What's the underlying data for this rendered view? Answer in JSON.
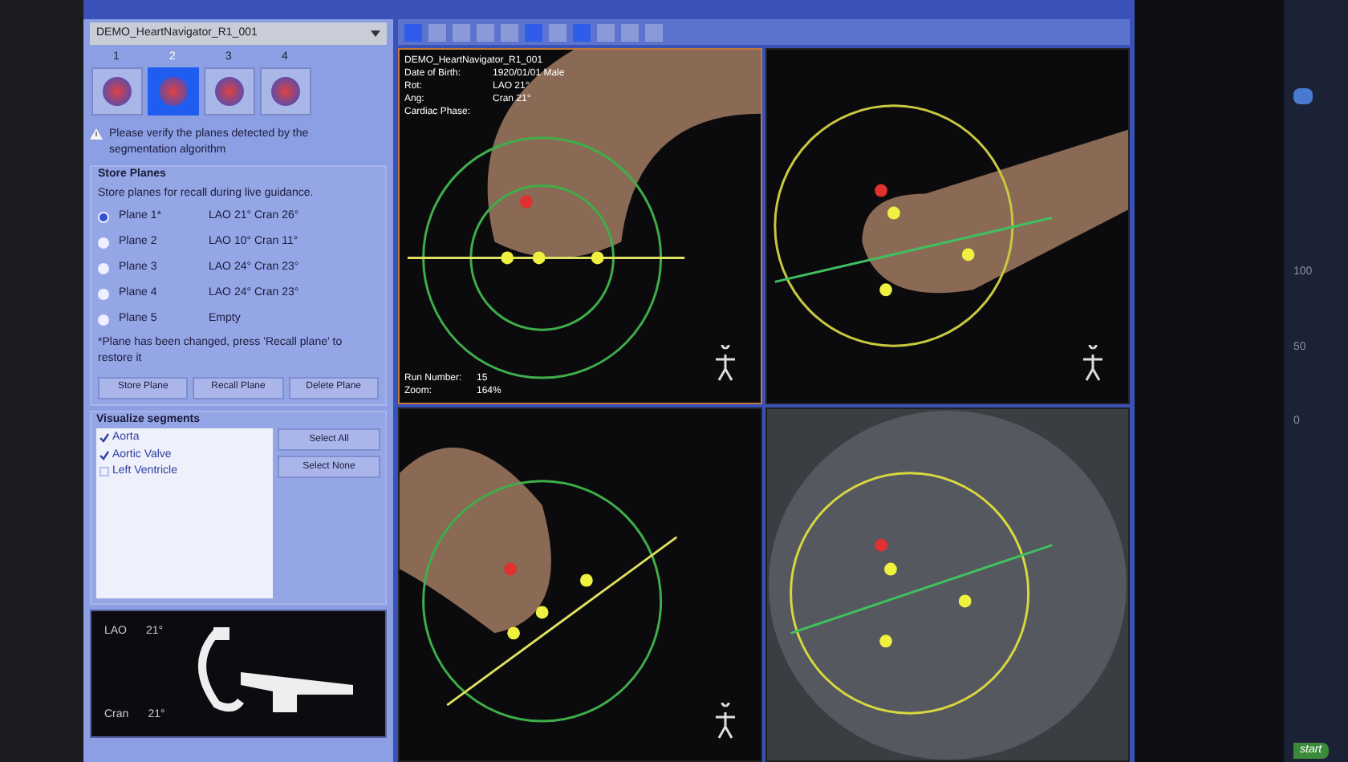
{
  "dataset": {
    "value": "DEMO_HeartNavigator_R1_001"
  },
  "steps": [
    {
      "label": "1",
      "selected": false
    },
    {
      "label": "2",
      "selected": true
    },
    {
      "label": "3",
      "selected": false
    },
    {
      "label": "4",
      "selected": false
    }
  ],
  "warning": "Please verify the planes detected by the segmentation algorithm",
  "store_planes": {
    "title": "Store Planes",
    "hint": "Store planes for recall during live guidance.",
    "planes": [
      {
        "name": "Plane 1*",
        "angles": "LAO 21° Cran 26°",
        "selected": true
      },
      {
        "name": "Plane 2",
        "angles": "LAO 10° Cran 11°",
        "selected": false
      },
      {
        "name": "Plane 3",
        "angles": "LAO 24° Cran 23°",
        "selected": false
      },
      {
        "name": "Plane 4",
        "angles": "LAO 24° Cran 23°",
        "selected": false
      },
      {
        "name": "Plane 5",
        "angles": "Empty",
        "selected": false
      }
    ],
    "note": "*Plane has been changed, press 'Recall plane' to restore it",
    "buttons": [
      "Store Plane",
      "Recall Plane",
      "Delete Plane"
    ]
  },
  "segments": {
    "title": "Visualize segments",
    "items": [
      {
        "label": "Aorta",
        "checked": true
      },
      {
        "label": "Aortic Valve",
        "checked": true
      },
      {
        "label": "Left Ventricle",
        "checked": false
      }
    ],
    "buttons": [
      "Select All",
      "Select None"
    ]
  },
  "carm": {
    "rot_label": "LAO",
    "rot_value": "21°",
    "ang_label": "Cran",
    "ang_value": "21°"
  },
  "viewport_info": [
    {
      "key": "DEMO_HeartNavigator_R1_001"
    },
    {
      "key": "Date of Birth:",
      "value": "1920/01/01 Male"
    },
    {
      "key": "Rot:",
      "value": "LAO 21°"
    },
    {
      "key": "Ang:",
      "value": "Cran 21°"
    },
    {
      "key": "Cardiac Phase:"
    }
  ],
  "viewport_footer": [
    {
      "key": "Run Number:",
      "value": "15"
    },
    {
      "key": "Zoom:",
      "value": "164%"
    }
  ],
  "monitor_scale": [
    "100",
    "50",
    "0"
  ],
  "taskbar": {
    "start": "start"
  }
}
